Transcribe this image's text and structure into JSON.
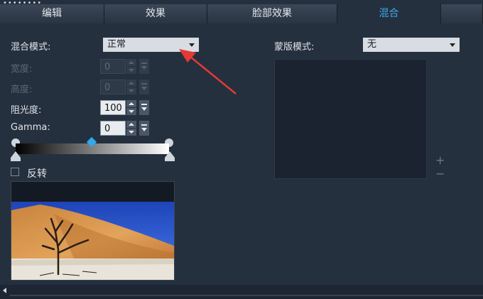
{
  "grip": "••••••••",
  "tabs": [
    {
      "label": "编辑",
      "active": false
    },
    {
      "label": "效果",
      "active": false
    },
    {
      "label": "脸部效果",
      "active": false
    },
    {
      "label": "混合",
      "active": true
    }
  ],
  "blend": {
    "mode_label": "混合模式:",
    "mode_value": "正常",
    "width_label": "宽度:",
    "width_value": "0",
    "height_label": "高度:",
    "height_value": "0",
    "opacity_label": "阻光度:",
    "opacity_value": "100",
    "gamma_label": "Gamma:",
    "gamma_value": "0",
    "invert_label": "反转",
    "invert_checked": false
  },
  "mask": {
    "mode_label": "蒙版模式:",
    "mode_value": "无",
    "plus": "+",
    "minus": "−"
  },
  "colors": {
    "background": "#25303e",
    "accent": "#2fa8ee",
    "annotation_arrow": "#e53935"
  },
  "icons": [
    "chevron-down-icon",
    "spin-up-icon",
    "spin-down-icon",
    "dropdown-icon",
    "plus-icon",
    "minus-icon",
    "scroll-left-icon"
  ]
}
